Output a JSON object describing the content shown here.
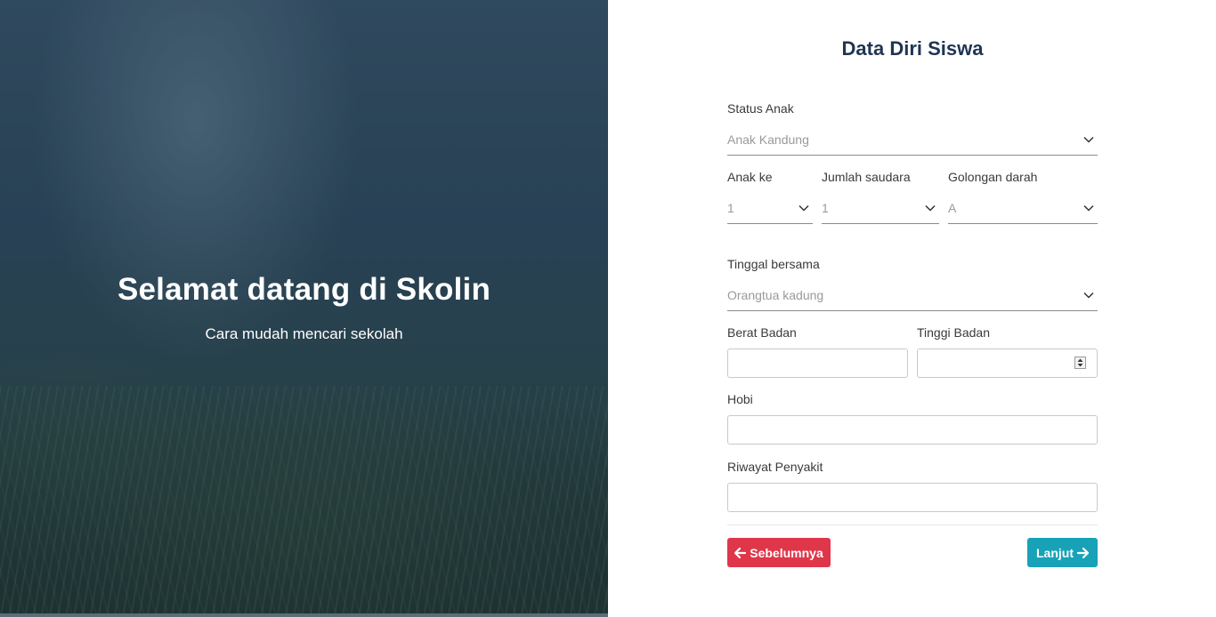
{
  "hero": {
    "title": "Selamat datang di Skolin",
    "subtitle": "Cara mudah mencari sekolah"
  },
  "form": {
    "title": "Data Diri Siswa",
    "status_anak": {
      "label": "Status Anak",
      "value": "Anak Kandung"
    },
    "anak_ke": {
      "label": "Anak ke",
      "value": "1"
    },
    "jumlah_saudara": {
      "label": "Jumlah saudara",
      "value": "1"
    },
    "golongan_darah": {
      "label": "Golongan darah",
      "value": "A"
    },
    "tinggal_bersama": {
      "label": "Tinggal bersama",
      "value": "Orangtua kadung"
    },
    "berat_badan": {
      "label": "Berat Badan",
      "value": ""
    },
    "tinggi_badan": {
      "label": "Tinggi Badan",
      "value": ""
    },
    "hobi": {
      "label": "Hobi",
      "value": ""
    },
    "riwayat_penyakit": {
      "label": "Riwayat Penyakit",
      "value": ""
    }
  },
  "buttons": {
    "prev_label": "Sebelumnya",
    "next_label": "Lanjut"
  },
  "icons": {
    "dropdown": "chevron-down-icon",
    "prev": "arrow-left-icon",
    "next": "arrow-right-icon",
    "spinner": "number-spinner-icon"
  },
  "colors": {
    "title": "#1f3553",
    "prev_button": "#e0364a",
    "next_button": "#17a2b8",
    "placeholder": "#9a9a9a"
  }
}
